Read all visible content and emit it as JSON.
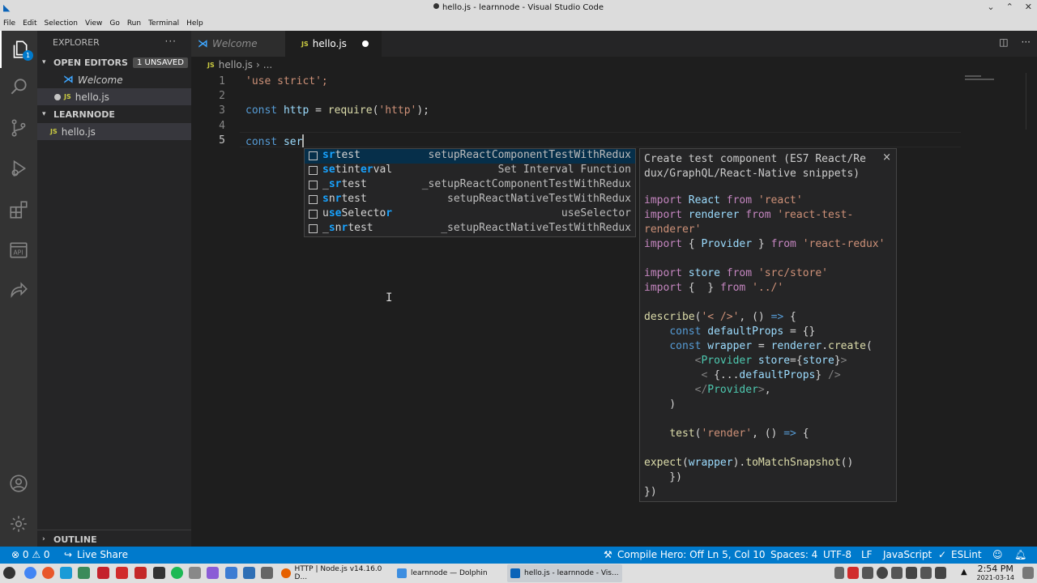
{
  "window": {
    "title": "hello.js - learnnode - Visual Studio Code"
  },
  "menu": [
    "File",
    "Edit",
    "Selection",
    "View",
    "Go",
    "Run",
    "Terminal",
    "Help"
  ],
  "activity_bar": {
    "explorer_badge": "1",
    "icons": [
      "explorer-icon",
      "search-icon",
      "source-control-icon",
      "run-debug-icon",
      "extensions-icon",
      "api-icon",
      "live-share-icon",
      "account-icon",
      "settings-gear-icon"
    ]
  },
  "sidebar": {
    "title": "EXPLORER",
    "more": "···",
    "open_editors": {
      "label": "OPEN EDITORS",
      "badge": "1 UNSAVED",
      "items": [
        {
          "name": "Welcome",
          "icon": "vscode-icon"
        },
        {
          "name": "hello.js",
          "icon": "js-icon",
          "badge": "JS"
        }
      ]
    },
    "project": {
      "label": "LEARNNODE",
      "files": [
        {
          "name": "hello.js",
          "badge": "JS"
        }
      ]
    },
    "outline_label": "OUTLINE"
  },
  "tabs": [
    {
      "label": "Welcome",
      "icon": "vscode-icon"
    },
    {
      "label": "hello.js",
      "badge": "JS",
      "modified": true
    }
  ],
  "breadcrumb": {
    "badge": "JS",
    "file": "hello.js",
    "sep": "›",
    "rest": "..."
  },
  "editor": {
    "line_numbers": [
      "1",
      "2",
      "3",
      "4",
      "5"
    ],
    "line1": "'use strict';",
    "line3_kw": "const",
    "line3_var": "http",
    "line3_eq": "=",
    "line3_fn": "require",
    "line3_open": "(",
    "line3_str": "'http'",
    "line3_close": ");",
    "line5_kw": "const",
    "line5_typed": "ser"
  },
  "suggest": [
    {
      "pre": "",
      "m1": "s",
      "mid": "",
      "m2": "r",
      "mid2": "",
      "m3": "",
      "post": "test",
      "detail": "setupReactComponentTestWithRedux"
    },
    {
      "pre": "",
      "m1": "se",
      "mid": "tint",
      "m2": "er",
      "mid2": "",
      "m3": "",
      "post": "val",
      "detail": "Set Interval Function"
    },
    {
      "pre": "_",
      "m1": "s",
      "mid": "",
      "m2": "r",
      "mid2": "",
      "m3": "",
      "post": "test",
      "detail": "_setupReactComponentTestWithRedux"
    },
    {
      "pre": "",
      "m1": "s",
      "mid": "n",
      "m2": "r",
      "mid2": "",
      "m3": "",
      "post": "test",
      "detail": "setupReactNativeTestWithRedux"
    },
    {
      "pre": "u",
      "m1": "se",
      "mid": "Selecto",
      "m2": "r",
      "mid2": "",
      "m3": "",
      "post": "",
      "detail": "useSelector"
    },
    {
      "pre": "_",
      "m1": "s",
      "mid": "n",
      "m2": "r",
      "mid2": "",
      "m3": "",
      "post": "test",
      "detail": "_setupReactNativeTestWithRedux"
    }
  ],
  "details": {
    "title": "Create test component (ES7 React/Re\ndux/GraphQL/React-Native snippets)",
    "close": "×"
  },
  "status": {
    "errors": "⊗ 0 ⚠ 0",
    "live_share": "Live Share",
    "compile_hero": "Compile Hero: Off",
    "position": "Ln 5, Col 10",
    "spaces": "Spaces: 4",
    "encoding": "UTF-8",
    "eol": "LF",
    "language": "JavaScript",
    "eslint": "ESLint"
  },
  "taskbar": {
    "tasks": [
      "HTTP | Node.js v14.16.0 D...",
      "learnnode — Dolphin",
      "hello.js - learnnode - Vis..."
    ],
    "time": "2:54 PM",
    "date": "2021-03-14"
  },
  "colors": {
    "accent": "#007acc",
    "editor_bg": "#1e1e1e",
    "sidebar_bg": "#252526",
    "activity_bg": "#333333"
  }
}
